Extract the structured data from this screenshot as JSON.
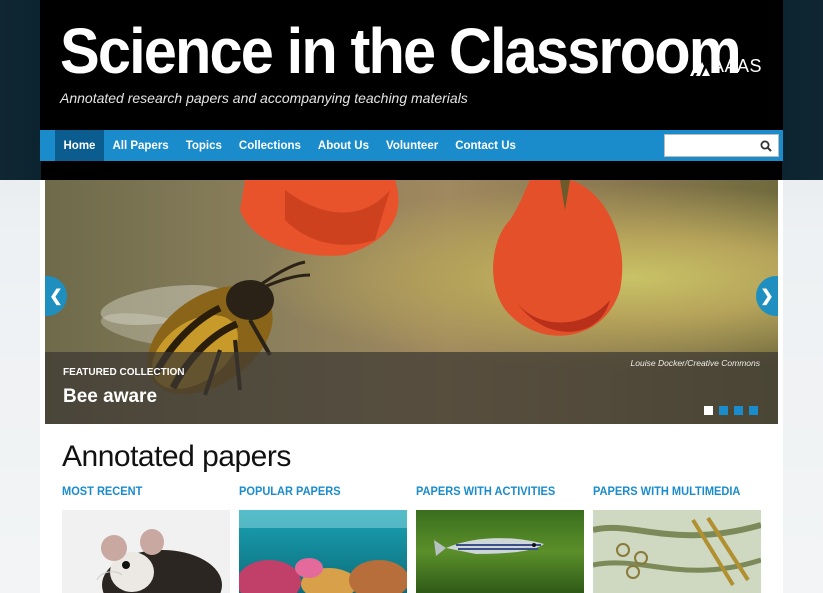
{
  "header": {
    "title": "Science in the Classroom",
    "subtitle": "Annotated research papers and accompanying teaching materials",
    "logo_text": "AAAS"
  },
  "nav": {
    "items": [
      {
        "label": "Home",
        "active": true
      },
      {
        "label": "All Papers"
      },
      {
        "label": "Topics"
      },
      {
        "label": "Collections"
      },
      {
        "label": "About Us"
      },
      {
        "label": "Volunteer"
      },
      {
        "label": "Contact Us"
      }
    ],
    "search_placeholder": "",
    "search_icon": "search-icon"
  },
  "slider": {
    "credit": "Louise Docker/Creative Commons",
    "label": "FEATURED COLLECTION",
    "title": "Bee aware",
    "prev_arrow": "❮",
    "next_arrow": "❯",
    "dots": 4,
    "active_dot": 0
  },
  "papers": {
    "heading": "Annotated papers",
    "categories": [
      "MOST RECENT",
      "POPULAR PAPERS",
      "PAPERS WITH ACTIVITIES",
      "PAPERS WITH MULTIMEDIA"
    ]
  },
  "colors": {
    "accent": "#1a8ccc",
    "nav_active": "#0b5d8f",
    "header_bg": "#000000"
  }
}
